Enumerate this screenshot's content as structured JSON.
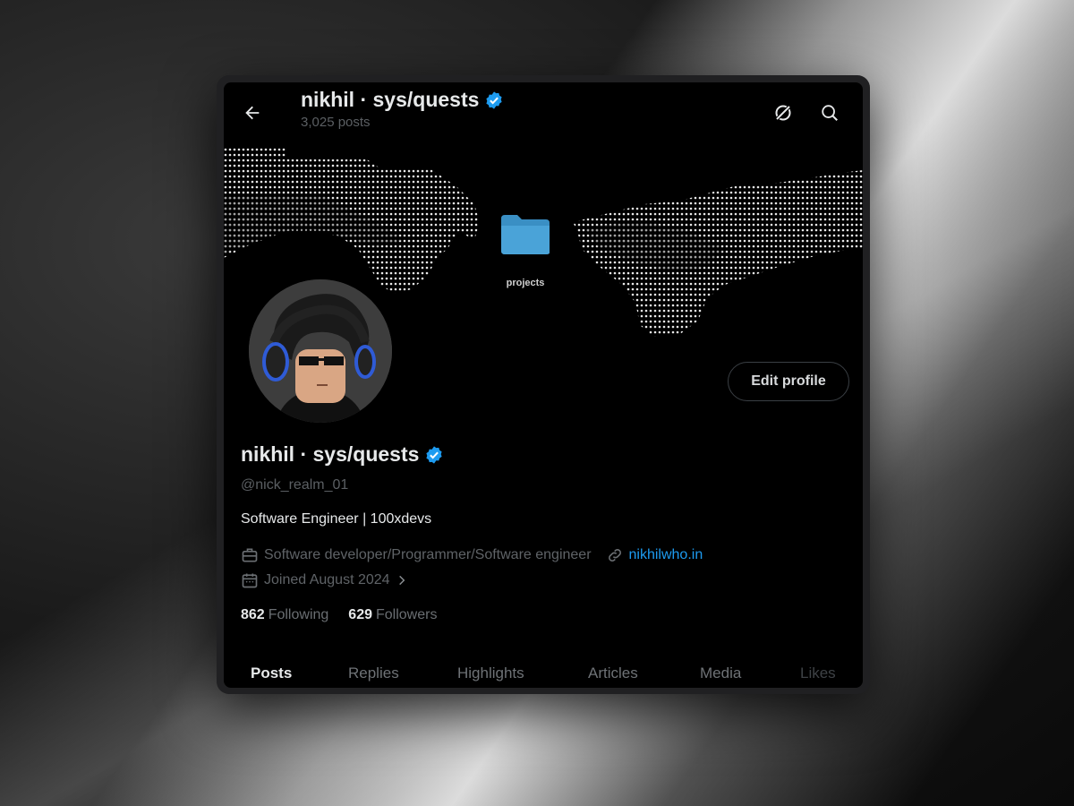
{
  "header": {
    "title": "nikhil · sys/quests",
    "posts_count": "3,025 posts"
  },
  "banner": {
    "folder_label": "projects"
  },
  "profile": {
    "name": "nikhil · sys/quests",
    "handle": "@nick_realm_01",
    "bio": "Software Engineer | 100xdevs",
    "profession": "Software developer/Programmer/Software engineer",
    "website": "nikhilwho.in",
    "joined": "Joined August 2024",
    "edit_label": "Edit profile"
  },
  "stats": {
    "following_count": "862",
    "following_label": "Following",
    "followers_count": "629",
    "followers_label": "Followers"
  },
  "tabs": [
    {
      "label": "Posts"
    },
    {
      "label": "Replies"
    },
    {
      "label": "Highlights"
    },
    {
      "label": "Articles"
    },
    {
      "label": "Media"
    },
    {
      "label": "Likes"
    }
  ],
  "colors": {
    "accent": "#1d9bf0",
    "background": "#000000",
    "text_primary": "#e7e9ea",
    "text_secondary": "#5b5f63"
  },
  "icons": {
    "back": "arrow-left-icon",
    "grok": "grok-icon",
    "search": "search-icon",
    "verified": "verified-badge-icon",
    "profession": "briefcase-icon",
    "link": "link-icon",
    "calendar": "calendar-icon"
  }
}
